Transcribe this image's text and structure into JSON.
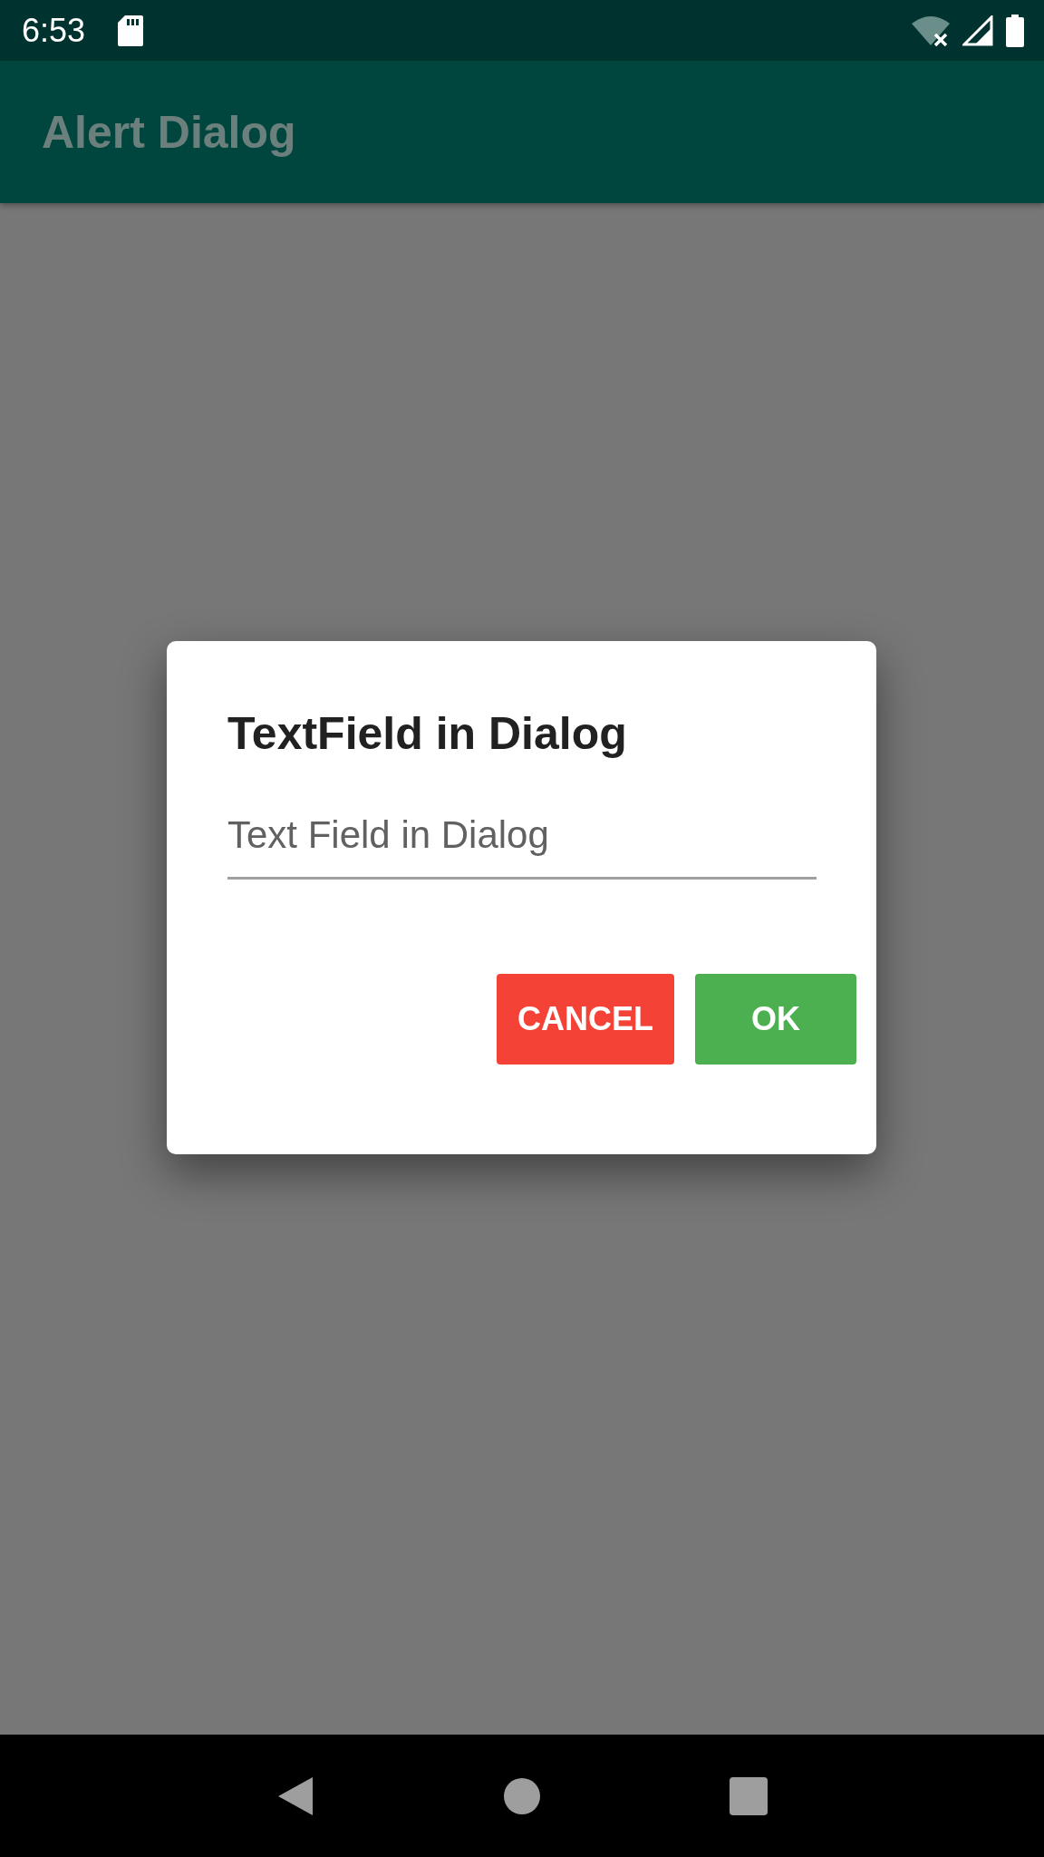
{
  "status_bar": {
    "time": "6:53"
  },
  "app_bar": {
    "title": "Alert Dialog"
  },
  "dialog": {
    "title": "TextField in Dialog",
    "field": {
      "placeholder": "Text Field in Dialog"
    },
    "buttons": [
      {
        "label": "CANCEL",
        "kind": "cancel"
      },
      {
        "label": "OK",
        "kind": "ok"
      }
    ]
  }
}
